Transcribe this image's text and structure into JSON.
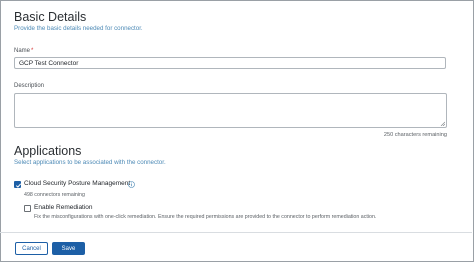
{
  "basic_details": {
    "title": "Basic Details",
    "subtitle": "Provide the basic details needed for connector.",
    "name_label": "Name",
    "name_required_marker": "*",
    "name_value": "GCP Test Connector",
    "description_label": "Description",
    "description_value": "",
    "characters_remaining": "250 characters remaining"
  },
  "applications": {
    "title": "Applications",
    "subtitle": "Select applications to be associated with the connector.",
    "items": [
      {
        "label": "Cloud Security Posture Management",
        "checked": true,
        "note": "498 connectors remaining",
        "info_icon": "info-icon"
      }
    ],
    "remediation": {
      "label": "Enable Remediation",
      "checked": false,
      "description": "Fix the misconfigurations with one-click remediation. Ensure the required permissions are provided to the connector to perform remediation action."
    }
  },
  "footer": {
    "cancel_label": "Cancel",
    "save_label": "Save"
  },
  "colors": {
    "accent": "#1d5fa6",
    "subtitle": "#4d8ab6",
    "required": "#d32f2f"
  }
}
